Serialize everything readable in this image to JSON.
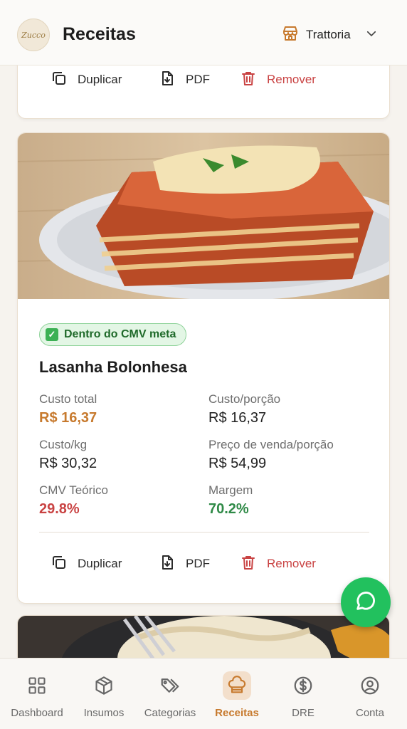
{
  "header": {
    "logo_text": "Zucco",
    "title": "Receitas",
    "store": "Trattoria"
  },
  "top_card": {
    "actions": {
      "duplicate": "Duplicar",
      "pdf": "PDF",
      "remove": "Remover"
    }
  },
  "recipe": {
    "badge": "Dentro do CMV meta",
    "name": "Lasanha Bolonhesa",
    "stats": {
      "custo_total": {
        "label": "Custo total",
        "value": "R$ 16,37"
      },
      "custo_porcao": {
        "label": "Custo/porção",
        "value": "R$ 16,37"
      },
      "custo_kg": {
        "label": "Custo/kg",
        "value": "R$ 30,32"
      },
      "preco_venda": {
        "label": "Preço de venda/porção",
        "value": "R$ 54,99"
      },
      "cmv": {
        "label": "CMV Teórico",
        "value": "29.8%"
      },
      "margem": {
        "label": "Margem",
        "value": "70.2%"
      }
    },
    "actions": {
      "duplicate": "Duplicar",
      "pdf": "PDF",
      "remove": "Remover"
    }
  },
  "bottom_nav": {
    "items": [
      {
        "label": "Dashboard",
        "icon": "dashboard-icon"
      },
      {
        "label": "Insumos",
        "icon": "box-icon"
      },
      {
        "label": "Categorias",
        "icon": "tags-icon"
      },
      {
        "label": "Receitas",
        "icon": "chef-hat-icon",
        "active": true
      },
      {
        "label": "DRE",
        "icon": "dollar-icon"
      },
      {
        "label": "Conta",
        "icon": "user-icon"
      }
    ]
  },
  "colors": {
    "accent": "#c77a2e",
    "danger": "#c94343",
    "success": "#2f8a47",
    "whatsapp": "#22c15e"
  }
}
